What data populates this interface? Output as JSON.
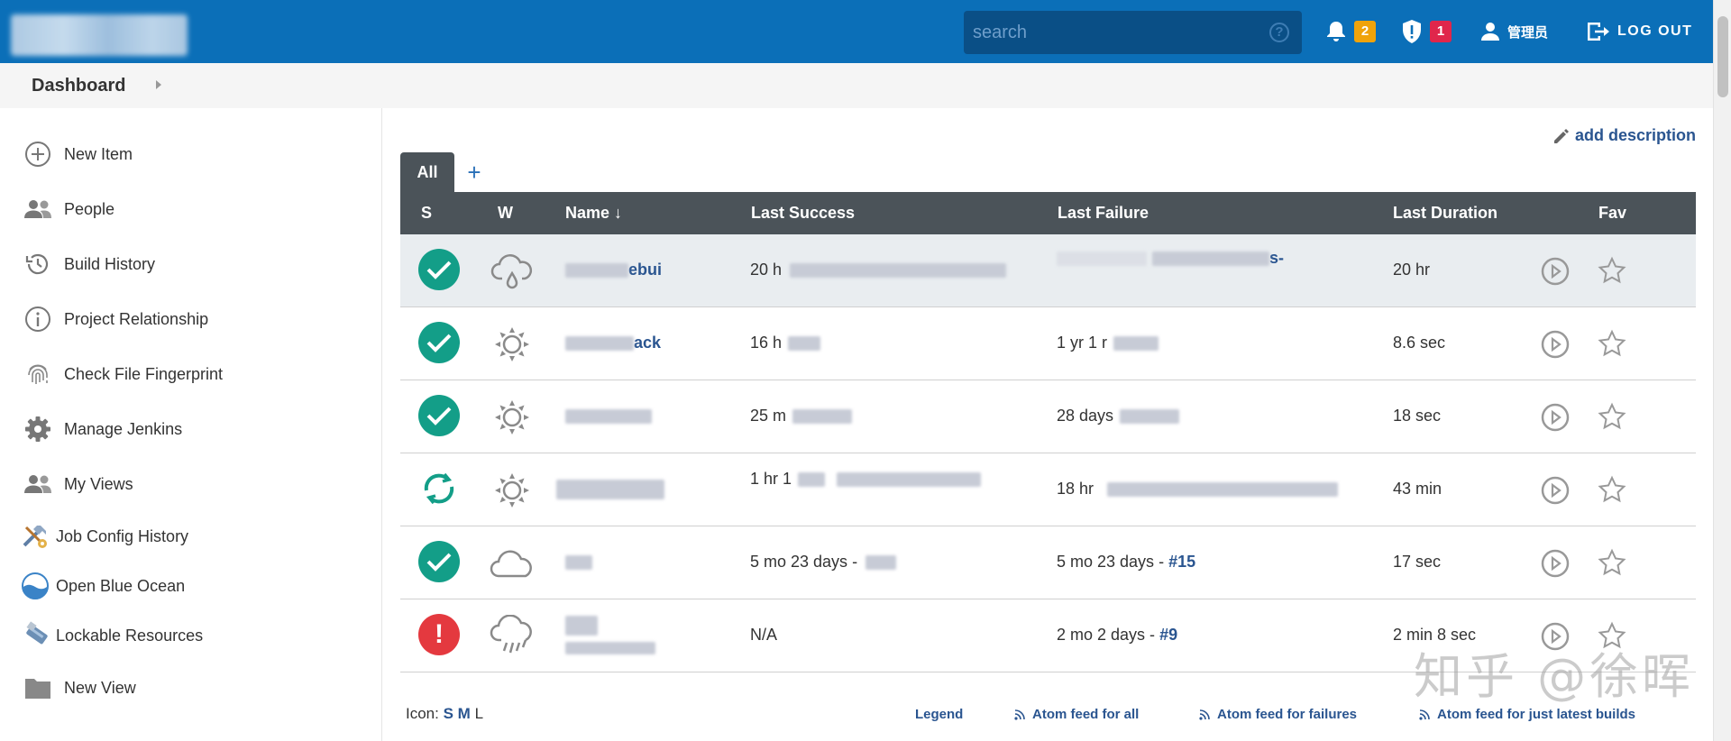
{
  "header": {
    "search_placeholder": "search",
    "help_symbol": "?",
    "notifications_count": "2",
    "security_count": "1",
    "user_name": "管理员",
    "logout_label": "LOG OUT",
    "colors": {
      "header_bg": "#0b6fb8",
      "badge_orange": "#f0a30a",
      "badge_red": "#e0264b"
    }
  },
  "breadcrumb": {
    "label": "Dashboard"
  },
  "sidebar": {
    "items": [
      {
        "label": "New Item",
        "icon": "plus-circle-icon"
      },
      {
        "label": "People",
        "icon": "people-icon"
      },
      {
        "label": "Build History",
        "icon": "history-icon"
      },
      {
        "label": "Project Relationship",
        "icon": "info-icon"
      },
      {
        "label": "Check File Fingerprint",
        "icon": "fingerprint-icon"
      },
      {
        "label": "Manage Jenkins",
        "icon": "gear-icon"
      },
      {
        "label": "My Views",
        "icon": "people-icon"
      },
      {
        "label": "Job Config History",
        "icon": "tools-icon"
      },
      {
        "label": "Open Blue Ocean",
        "icon": "blue-ocean-icon"
      },
      {
        "label": "Lockable Resources",
        "icon": "usb-drive-icon"
      },
      {
        "label": "New View",
        "icon": "folder-icon"
      }
    ]
  },
  "main": {
    "add_description": "add description",
    "tabs": {
      "all": "All",
      "add": "+"
    },
    "columns": {
      "s": "S",
      "w": "W",
      "name": "Name",
      "sort_arrow": "↓",
      "last_success": "Last Success",
      "last_failure": "Last Failure",
      "last_duration": "Last Duration",
      "fav": "Fav"
    },
    "rows": [
      {
        "status": "success",
        "weather": "rain",
        "name_visible": "ebui",
        "last_success": "20 h",
        "last_failure_visible": "s-",
        "last_duration": "20 hr"
      },
      {
        "status": "success",
        "weather": "sunny",
        "name_visible": "ack",
        "last_success": "16 h",
        "last_failure": "1 yr 1 r",
        "last_duration": "8.6 sec"
      },
      {
        "status": "success",
        "weather": "sunny",
        "name_visible": "",
        "last_success": "25 m",
        "last_failure": "28 days",
        "last_duration": "18 sec"
      },
      {
        "status": "running",
        "weather": "sunny",
        "name_visible": "",
        "last_success": "1 hr 1",
        "last_failure": "18 hr",
        "last_duration": "43 min"
      },
      {
        "status": "success",
        "weather": "cloudy",
        "name_visible": "",
        "last_success": "5 mo 23 days -",
        "last_failure": "5 mo 23 days -",
        "last_failure_build": "#15",
        "last_duration": "17 sec"
      },
      {
        "status": "failure",
        "weather": "storm",
        "name_visible": "",
        "last_success": "N/A",
        "last_failure": "2 mo 2 days -",
        "last_failure_build": "#9",
        "last_duration": "2 min 8 sec"
      }
    ]
  },
  "footer": {
    "icon_label": "Icon:",
    "size_s": "S",
    "size_m": "M",
    "size_l": "L",
    "legend": "Legend",
    "atom_all": "Atom feed for all",
    "atom_failures": "Atom feed for failures",
    "atom_latest": "Atom feed for just latest builds"
  },
  "watermark": "知乎 @徐晖"
}
